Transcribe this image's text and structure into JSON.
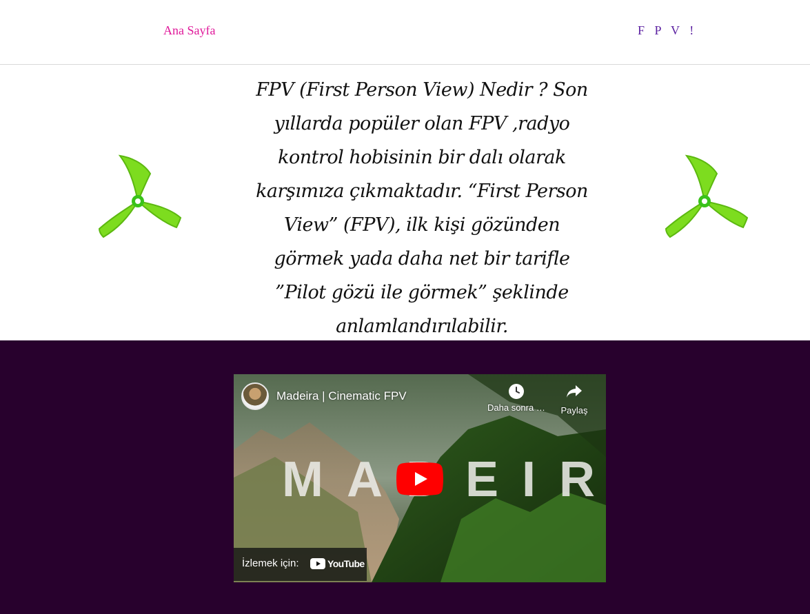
{
  "nav": {
    "home_label": "Ana Sayfa",
    "fpv_label": "F P V !"
  },
  "hero": {
    "text": "FPV (First Person View) Nedir ? Son yıllarda popüler olan FPV ,radyo kontrol hobisinin bir dalı olarak karşımıza çıkmaktadır. “First Person View” (FPV), ilk kişi gözünden görmek yada daha net bir tarifle ”Pilot gözü ile görmek” şeklinde anlamlandırılabilir."
  },
  "video": {
    "title": "Madeira | Cinematic FPV",
    "watch_later_label": "Daha sonra izle",
    "share_label": "Paylaş",
    "overlay_text": "MADEIRA",
    "watch_on_label": "İzlemek için:",
    "youtube_label": "YouTube"
  },
  "colors": {
    "home_link": "#e0189a",
    "fpv_link": "#5a1fa0",
    "video_section_bg": "#28012d",
    "propeller": "#7ddc1f"
  },
  "icons": {
    "propeller_left": "propeller-icon",
    "propeller_right": "propeller-icon",
    "play": "play-icon",
    "clock": "clock-icon",
    "share": "share-arrow-icon",
    "youtube": "youtube-logo-icon"
  }
}
